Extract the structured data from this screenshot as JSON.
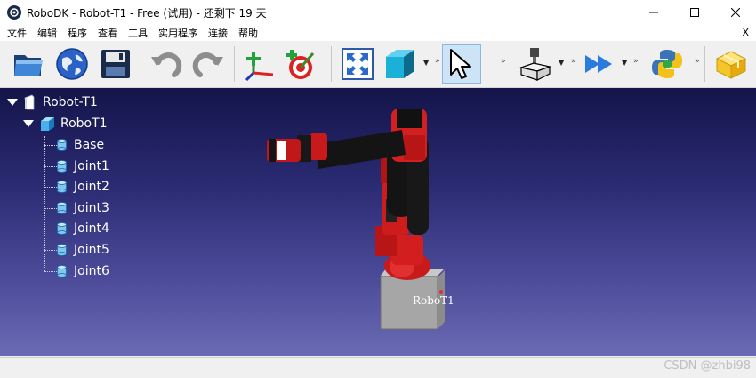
{
  "window": {
    "title": "RoboDK - Robot-T1 - Free (试用) - 还剩下 19 天",
    "minimize_icon": "minimize-icon",
    "maximize_icon": "maximize-icon",
    "close_icon": "close-icon"
  },
  "menu": {
    "items": [
      "文件",
      "编辑",
      "程序",
      "查看",
      "工具",
      "实用程序",
      "连接",
      "帮助"
    ],
    "close_label": "X"
  },
  "toolbar": {
    "icons": [
      "open-folder-icon",
      "online-library-icon",
      "save-icon",
      "undo-icon",
      "redo-icon",
      "add-reference-frame-icon",
      "add-target-icon",
      "fit-all-icon",
      "view-cube-icon",
      "select-cursor-icon",
      "machining-project-icon",
      "run-program-icon",
      "python-program-icon",
      "package-icon"
    ],
    "overflow_label": "»"
  },
  "tree": {
    "station": "Robot-T1",
    "robot": "RoboT1",
    "joints": [
      "Base",
      "Joint1",
      "Joint2",
      "Joint3",
      "Joint4",
      "Joint5",
      "Joint6"
    ]
  },
  "viewport": {
    "robot_label": "RoboT1"
  },
  "status": {
    "watermark": "CSDN @zhbi98"
  },
  "colors": {
    "viewport_top": "#14144a",
    "viewport_bottom": "#6a6ab4",
    "robot_red": "#d81e1e"
  }
}
